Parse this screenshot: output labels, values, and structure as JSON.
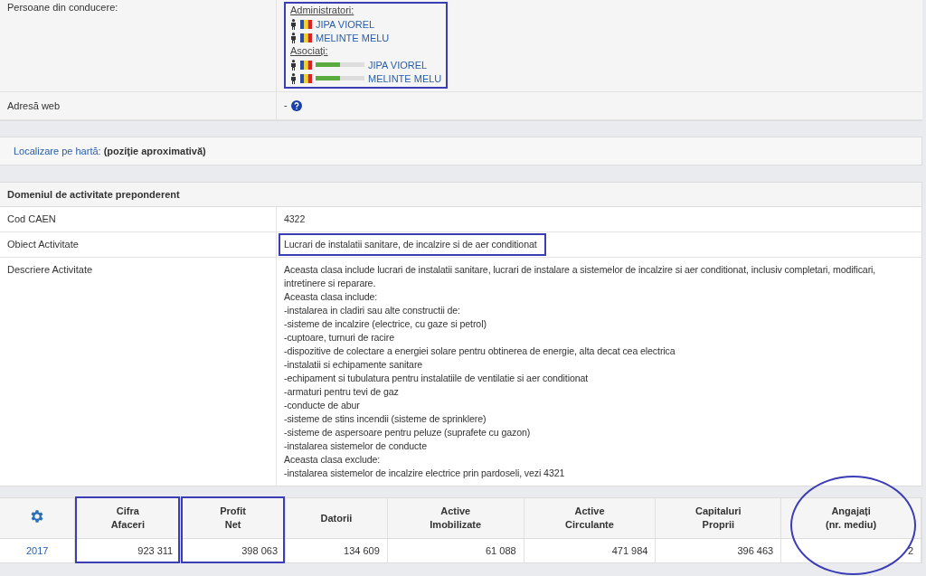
{
  "company_panel": {
    "rows": [
      {
        "kind": "persons",
        "label": "Persoane din conducere:",
        "boxed": true,
        "groups": [
          {
            "title": "Administratori:",
            "people": [
              {
                "name": "JIPA VIOREL"
              },
              {
                "name": "MELINTE MELU"
              }
            ]
          },
          {
            "title": "Asociați:",
            "people": [
              {
                "name": "JIPA VIOREL",
                "level": 0.5
              },
              {
                "name": "MELINTE MELU",
                "level": 0.5
              }
            ]
          }
        ]
      },
      {
        "kind": "web",
        "label": "Adresă web",
        "value": "-"
      }
    ]
  },
  "map_bar": {
    "link": "Localizare pe hartă:",
    "note": "(poziţie aproximativă)"
  },
  "activity": {
    "title": "Domeniul de activitate preponderent",
    "rows": [
      {
        "label": "Cod CAEN",
        "value": "4322",
        "boxed": false
      },
      {
        "label": "Obiect Activitate",
        "value": "Lucrari de instalatii sanitare, de incalzire si de aer conditionat",
        "boxed": true
      },
      {
        "label": "Descriere Activitate",
        "value": "Aceasta clasa include lucrari de instalatii sanitare, lucrari de instalare a sistemelor de incalzire si aer conditionat, inclusiv completari, modificari, intretinere si reparare.\nAceasta clasa include:\n-instalarea in cladiri sau alte constructii de:\n-sisteme de incalzire (electrice, cu gaze si petrol)\n-cuptoare, turnuri de racire\n-dispozitive de colectare a energiei solare pentru obtinerea de energie, alta decat cea electrica\n-instalatii si echipamente sanitare\n-echipament si tubulatura pentru instalatiile de ventilatie si aer conditionat\n-armaturi pentru tevi de gaz\n-conducte de abur\n-sisteme de stins incendii (sisteme de sprinklere)\n-sisteme de aspersoare pentru peluze (suprafete cu gazon)\n-instalarea sistemelor de conducte\nAceasta clasa exclude:\n-instalarea sistemelor de incalzire electrice prin pardoseli, vezi 4321",
        "boxed": false
      }
    ]
  },
  "financials": {
    "columns": [
      {
        "label": "Cifra\nAfaceri",
        "boxed": true,
        "circled": false
      },
      {
        "label": "Profit\nNet",
        "boxed": true,
        "circled": false
      },
      {
        "label": "Datorii",
        "boxed": false,
        "circled": false
      },
      {
        "label": "Active\nImobilizate",
        "boxed": false,
        "circled": false
      },
      {
        "label": "Active\nCirculante",
        "boxed": false,
        "circled": false
      },
      {
        "label": "Capitaluri\nProprii",
        "boxed": false,
        "circled": false
      },
      {
        "label": "Angajați\n(nr. mediu)",
        "boxed": false,
        "circled": true
      }
    ],
    "rows": [
      {
        "year": "2017",
        "cells": [
          "923 311",
          "398 063",
          "134 609",
          "61 088",
          "471 984",
          "396 463",
          "2"
        ]
      }
    ]
  }
}
